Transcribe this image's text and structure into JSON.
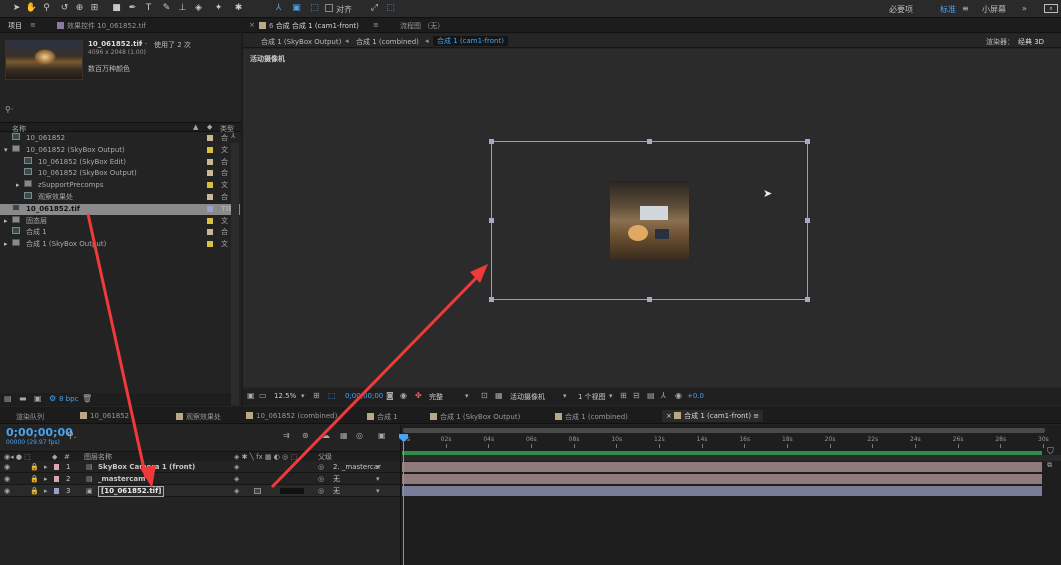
{
  "toolbar": {
    "tools": [
      "selection-icon",
      "hand-icon",
      "zoom-icon",
      "rotate-icon",
      "camera-orbit-icon",
      "rect-icon",
      "pen-icon",
      "text-icon",
      "brush-icon",
      "stamp-icon",
      "eraser-icon",
      "puppet-icon"
    ],
    "snap_label": "对齐",
    "workspaces": [
      "必要项",
      "标准",
      "小屏幕"
    ],
    "active_workspace": "标准"
  },
  "project": {
    "tab_label": "项目",
    "effects_tab": "效果控件 10_061852.tif",
    "file_name": "10_061852.tif",
    "used_label": "使用了 2 次",
    "dimensions": "4096 x 2048 (1.00)",
    "colors": "数百万种颜色",
    "col_name": "名称",
    "col_type": "类型",
    "items": [
      {
        "name": "10_061852",
        "indent": 0,
        "icon": "comp",
        "type": "合"
      },
      {
        "name": "10_061852 (SkyBox Output)",
        "indent": 0,
        "icon": "folder",
        "type": "文",
        "open": true
      },
      {
        "name": "10_061852 (SkyBox Edit)",
        "indent": 1,
        "icon": "comp",
        "type": "合"
      },
      {
        "name": "10_061852 (SkyBox Output)",
        "indent": 1,
        "icon": "comp",
        "type": "合"
      },
      {
        "name": "zSupportPrecomps",
        "indent": 1,
        "icon": "folder",
        "type": "文"
      },
      {
        "name": "观察效果处",
        "indent": 1,
        "icon": "comp",
        "type": "合"
      },
      {
        "name": "10_061852.tif",
        "indent": 0,
        "icon": "file",
        "type": "TIF",
        "selected": true
      },
      {
        "name": "固态层",
        "indent": 0,
        "icon": "folder",
        "type": "文"
      },
      {
        "name": "合成 1",
        "indent": 0,
        "icon": "comp",
        "type": "合"
      },
      {
        "name": "合成 1 (SkyBox Output)",
        "indent": 0,
        "icon": "folder",
        "type": "文"
      }
    ],
    "bpc": "8 bpc"
  },
  "composition": {
    "tab_label": "合成 合成 1 (cam1-front)",
    "flow_tab": "流程图 （无）",
    "breadcrumbs": [
      "合成 1 (SkyBox Output)",
      "合成 1 (combined)",
      "合成 1 (cam1-front)"
    ],
    "renderer_label": "渲染器：",
    "renderer_value": "经典 3D",
    "camera_label": "活动摄像机",
    "zoom": "12.5%",
    "timecode": "0;00;00;00",
    "quality": "完整",
    "active_camera": "活动摄像机",
    "views": "1 个视图",
    "exposure": "+0.0"
  },
  "timeline": {
    "tabs": [
      "渲染队列",
      "10_061852",
      "观察效果处",
      "10_061852 (combined)",
      "合成 1",
      "合成 1 (SkyBox Output)",
      "合成 1 (combined)",
      "合成 1 (cam1-front)"
    ],
    "active_tab": "合成 1 (cam1-front)",
    "timecode": "0;00;00;00",
    "frame_info": "00000 (29.97 fps)",
    "search_placeholder": "",
    "col_layer_name": "图层名称",
    "col_parent": "父级",
    "layers": [
      {
        "num": "1",
        "name": "SkyBox Camera 1 (front)",
        "parent": "2. _mastercar",
        "color": "#d8a8b0",
        "bar": "#8f7a7c"
      },
      {
        "num": "2",
        "name": "_mastercam",
        "parent": "无",
        "color": "#d8a8b0",
        "bar": "#8f7a7c"
      },
      {
        "num": "3",
        "name": "[10_061852.tif]",
        "parent": "无",
        "color": "#9aa0c8",
        "bar": "#7a7d98"
      }
    ],
    "ruler": [
      "0s",
      "02s",
      "04s",
      "06s",
      "08s",
      "10s",
      "12s",
      "14s",
      "16s",
      "18s",
      "20s",
      "22s",
      "24s",
      "26s",
      "28s",
      "30s"
    ]
  },
  "colors": {
    "accent": "#4aa3f0",
    "arrow": "#f03a3a",
    "bg_dark": "#1b1b1b",
    "panel": "#232323"
  }
}
